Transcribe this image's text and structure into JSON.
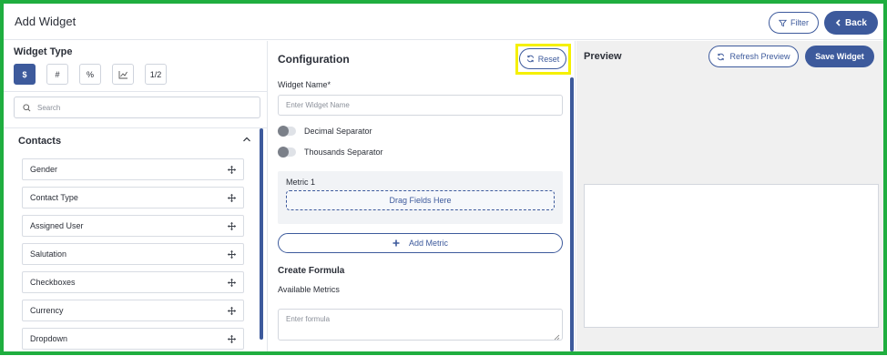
{
  "header": {
    "title": "Add Widget",
    "filter_label": "Filter",
    "back_label": "Back"
  },
  "left_panel": {
    "widget_type_label": "Widget Type",
    "widget_types": [
      "$",
      "#",
      "%",
      "chart-icon",
      "1/2"
    ],
    "active_widget_type": "$",
    "search_placeholder": "Search",
    "section_title": "Contacts",
    "fields": [
      "Gender",
      "Contact Type",
      "Assigned User",
      "Salutation",
      "Checkboxes",
      "Currency",
      "Dropdown"
    ]
  },
  "config": {
    "title": "Configuration",
    "reset_label": "Reset",
    "widget_name_label": "Widget Name*",
    "widget_name_placeholder": "Enter Widget Name",
    "decimal_separator_label": "Decimal Separator",
    "thousands_separator_label": "Thousands Separator",
    "metric_label": "Metric 1",
    "drop_zone_label": "Drag Fields Here",
    "add_metric_label": "Add Metric",
    "create_formula_label": "Create Formula",
    "available_metrics_label": "Available Metrics",
    "formula_placeholder": "Enter formula"
  },
  "preview": {
    "title": "Preview",
    "refresh_label": "Refresh Preview",
    "save_label": "Save Widget"
  },
  "colors": {
    "accent": "#3d5a9c",
    "frame_highlight": "#1fae3f",
    "reset_highlight": "#f5f000"
  }
}
